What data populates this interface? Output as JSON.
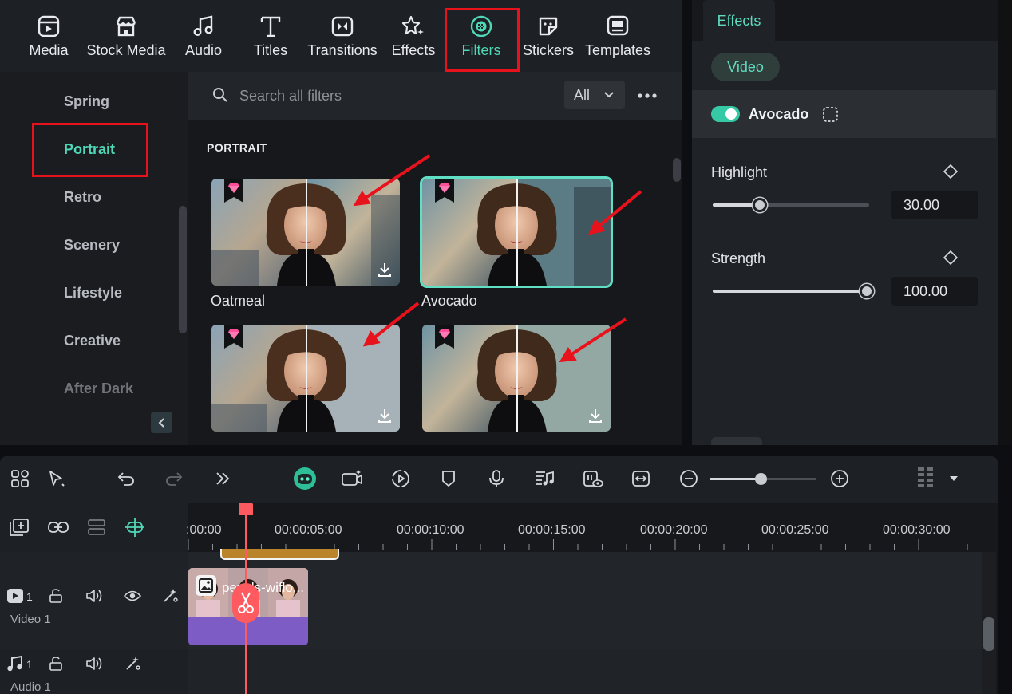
{
  "toolbar": {
    "tabs": [
      {
        "label": "Media",
        "icon": "media-icon"
      },
      {
        "label": "Stock Media",
        "icon": "stock-media-icon"
      },
      {
        "label": "Audio",
        "icon": "music-note-icon"
      },
      {
        "label": "Titles",
        "icon": "text-t-icon"
      },
      {
        "label": "Transitions",
        "icon": "transitions-icon"
      },
      {
        "label": "Effects",
        "icon": "effects-sparkle-icon"
      },
      {
        "label": "Filters",
        "icon": "filters-icon",
        "active": true
      },
      {
        "label": "Stickers",
        "icon": "sticker-icon"
      },
      {
        "label": "Templates",
        "icon": "templates-icon"
      }
    ]
  },
  "categories": {
    "items": [
      "Spring",
      "Portrait",
      "Retro",
      "Scenery",
      "Lifestyle",
      "Creative",
      "After Dark"
    ],
    "active": "Portrait"
  },
  "search": {
    "placeholder": "Search all filters",
    "dropdown_value": "All"
  },
  "grid": {
    "section_title": "PORTRAIT",
    "items": [
      {
        "label": "Oatmeal",
        "selected": false
      },
      {
        "label": "Avocado",
        "selected": true
      },
      {
        "label": "",
        "selected": false
      },
      {
        "label": "",
        "selected": false
      }
    ]
  },
  "effects_panel": {
    "tab": "Effects",
    "subtab": "Video",
    "effect_name": "Avocado",
    "effect_enabled": true,
    "params": [
      {
        "label": "Highlight",
        "value": "30.00",
        "fraction": 0.3
      },
      {
        "label": "Strength",
        "value": "100.00",
        "fraction": 1.0
      }
    ]
  },
  "timeline": {
    "ruler": [
      ":00:00",
      "00:00:05:00",
      "00:00:10:00",
      "00:00:15:00",
      "00:00:20:00",
      "00:00:25:00",
      "00:00:30:00"
    ],
    "clip_label": "pexels-wiflo...",
    "tracks": [
      {
        "name": "Video 1",
        "number": "1"
      },
      {
        "name": "Audio 1",
        "number": "1"
      }
    ]
  },
  "colors": {
    "accent": "#4fd8b7",
    "highlight_box": "#e8121c",
    "playhead": "#ff5a5f",
    "clip": "#7e5cc6"
  }
}
